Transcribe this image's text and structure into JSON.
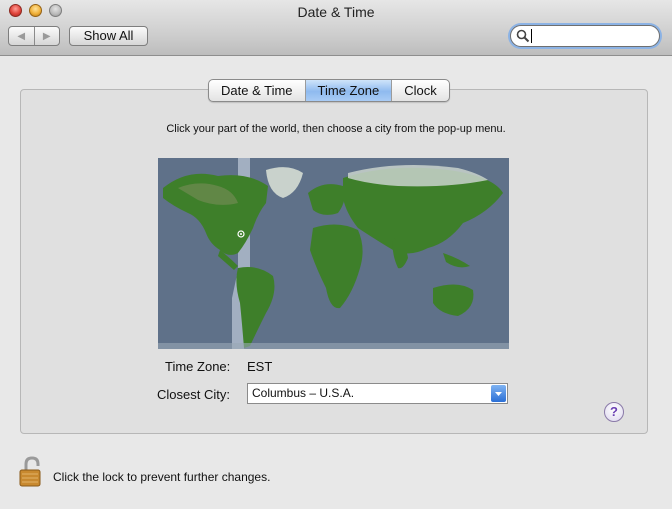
{
  "window": {
    "title": "Date & Time"
  },
  "toolbar": {
    "back_glyph": "◀",
    "forward_glyph": "▶",
    "show_all_label": "Show All",
    "search_value": ""
  },
  "tabs": [
    {
      "label": "Date & Time",
      "active": false
    },
    {
      "label": "Time Zone",
      "active": true
    },
    {
      "label": "Clock",
      "active": false
    }
  ],
  "instructions": "Click your part of the world, then choose a city from the pop-up menu.",
  "timezone": {
    "label": "Time Zone:",
    "value": "EST"
  },
  "closest_city": {
    "label": "Closest City:",
    "value": "Columbus – U.S.A."
  },
  "help_glyph": "?",
  "lock_text": "Click the lock to prevent further changes.",
  "colors": {
    "accent": "#8fbaef",
    "ocean": "#5f7189",
    "land": "#3e7f2a"
  },
  "icons": [
    "close-icon",
    "minimize-icon",
    "zoom-icon",
    "search-icon",
    "lock-icon",
    "help-icon",
    "chevron-down-icon",
    "location-marker-icon"
  ]
}
